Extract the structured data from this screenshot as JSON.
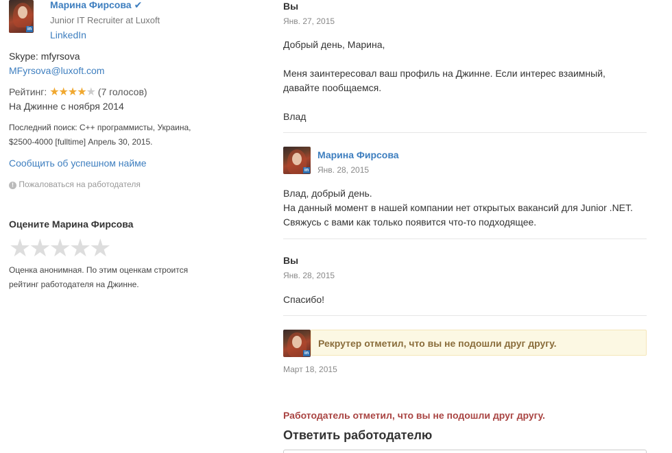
{
  "profile": {
    "name": "Марина Фирсова",
    "verified_icon": "check-icon",
    "title": "Junior IT Recruiter at Luxoft",
    "linkedin": "LinkedIn",
    "skype": "Skype: mfyrsova",
    "email": "MFyrsova@luxoft.com",
    "rating_label": "Рейтинг:",
    "rating_value": 4,
    "rating_votes": "(7 голосов)",
    "since": "На Джинне с ноября 2014",
    "last_search_line1": "Последний поиск: C++ программисты, Украина,",
    "last_search_line2": "$2500-4000 [fulltime] Апрель 30, 2015.",
    "report_hire": "Сообщить об успешном найме",
    "complain": "Пожаловаться на работодателя"
  },
  "rate": {
    "title": "Оцените Марина Фирсова",
    "note_line1": "Оценка анонимная. По этим оценкам строится",
    "note_line2": "рейтинг работодателя на Джинне."
  },
  "messages": [
    {
      "author": "Вы",
      "date": "Янв. 27, 2015",
      "lines": [
        "Добрый день, Марина,",
        "",
        "Меня заинтересовал ваш профиль на Джинне. Если интерес взаимный,",
        "давайте пообщаемся.",
        "",
        "Влад"
      ]
    },
    {
      "author": "Марина Фирсова",
      "date": "Янв. 28, 2015",
      "lines": [
        "Влад, добрый день.",
        "На данный момент в нашей компании нет открытых вакансий для Junior .NET.",
        "Свяжусь с вами как только появится что-то подходящее."
      ]
    },
    {
      "author": "Вы",
      "date": "Янв. 28, 2015",
      "lines": [
        "Спасибо!"
      ]
    }
  ],
  "recruiter_notice": {
    "text": "Рекрутер отметил, что вы не подошли друг другу.",
    "date": "Март 18, 2015"
  },
  "employer_notice": "Работодатель отметил, что вы не подошли друг другу.",
  "reply_title": "Ответить работодателю"
}
